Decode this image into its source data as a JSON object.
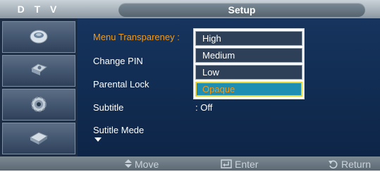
{
  "header": {
    "mode_label": "D T V",
    "title": "Setup"
  },
  "sidebar": {
    "items": [
      {
        "icon": "picture-icon"
      },
      {
        "icon": "sound-icon"
      },
      {
        "icon": "setup-gear-icon"
      },
      {
        "icon": "input-icon"
      }
    ]
  },
  "menu": {
    "items": [
      {
        "label": "Menu Transpareney :",
        "value": ""
      },
      {
        "label": "Change PIN",
        "value": ""
      },
      {
        "label": "Parental Lock",
        "value": ""
      },
      {
        "label": "Subtitle",
        "value": ": Off"
      },
      {
        "label": "Sutitle Mede",
        "value": ""
      }
    ],
    "active_index": 0
  },
  "dropdown": {
    "options": [
      "High",
      "Medium",
      "Low",
      "Opaque"
    ],
    "selected_index": 3
  },
  "footer": {
    "move_label": "Move",
    "enter_label": "Enter",
    "return_label": "Return"
  },
  "colors": {
    "accent_orange": "#f29a18",
    "selected_bg": "#1e8fb3",
    "selected_border": "#e8d23a",
    "panel_bg": "#16345e"
  }
}
